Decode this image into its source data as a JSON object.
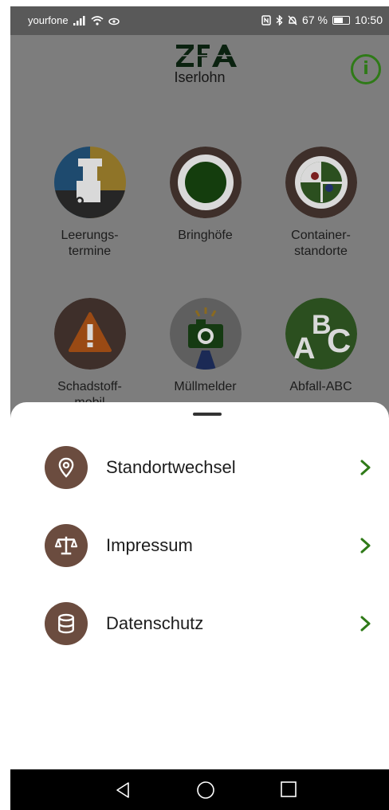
{
  "status_bar": {
    "carrier": "yourfone",
    "battery": "67 %",
    "battery_level": 0.67,
    "time": "10:50"
  },
  "header": {
    "logo_text": "ZfA",
    "city": "Iserlohn",
    "info_label": "i"
  },
  "tiles": [
    {
      "label": "Leerungs-\ntermine",
      "icon": "garbage-truck-icon"
    },
    {
      "label": "Bringhöfe",
      "icon": "recycling-yard-icon"
    },
    {
      "label": "Container-\nstandorte",
      "icon": "container-map-icon"
    },
    {
      "label": "Schadstoff-\nmobil",
      "icon": "hazard-warning-icon"
    },
    {
      "label": "Müllmelder",
      "icon": "camera-icon"
    },
    {
      "label": "Abfall-ABC",
      "icon": "abc-icon"
    }
  ],
  "sheet": {
    "items": [
      {
        "label": "Standortwechsel",
        "icon": "location-pin-icon"
      },
      {
        "label": "Impressum",
        "icon": "scales-icon"
      },
      {
        "label": "Datenschutz",
        "icon": "database-icon"
      }
    ]
  },
  "colors": {
    "accent_green": "#2f7a18",
    "icon_brown": "#6b4c3f",
    "scrim": "#7d7d7d"
  }
}
